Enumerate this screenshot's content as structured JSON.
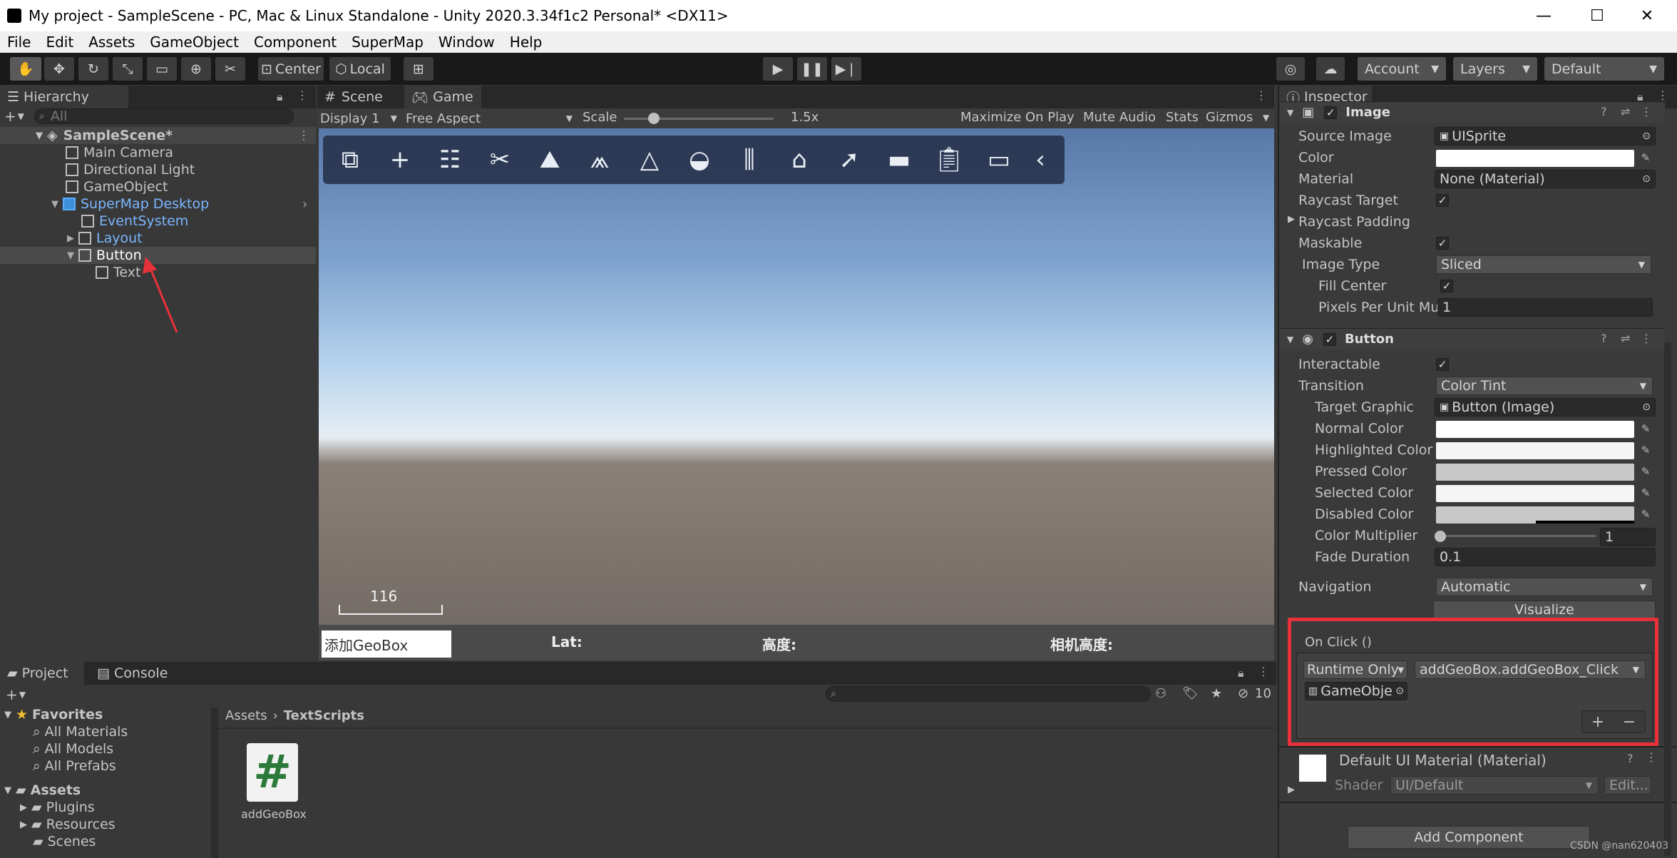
{
  "window": {
    "title": "My project - SampleScene - PC, Mac & Linux Standalone - Unity 2020.3.34f1c2 Personal* <DX11>"
  },
  "menu": [
    "File",
    "Edit",
    "Assets",
    "GameObject",
    "Component",
    "SuperMap",
    "Window",
    "Help"
  ],
  "toolbar": {
    "center": "Center",
    "local": "Local",
    "account": "Account",
    "layers": "Layers",
    "layout": "Default"
  },
  "hierarchy": {
    "tab": "Hierarchy",
    "search_placeholder": "All",
    "scene": "SampleScene*",
    "items": [
      {
        "label": "Main Camera"
      },
      {
        "label": "Directional Light"
      },
      {
        "label": "GameObject"
      },
      {
        "label": "SuperMap Desktop"
      },
      {
        "label": "EventSystem"
      },
      {
        "label": "Layout"
      },
      {
        "label": "Button"
      },
      {
        "label": "Text"
      }
    ]
  },
  "game": {
    "tabs": [
      "Scene",
      "Game"
    ],
    "display": "Display 1",
    "aspect": "Free Aspect",
    "scale_label": "Scale",
    "scale_value": "1.5x",
    "scale_fraction": 0.2,
    "maximize": "Maximize On Play",
    "mute": "Mute Audio",
    "stats": "Stats",
    "gizmos": "Gizmos",
    "scalebar_value": "116",
    "add_button": "添加GeoBox",
    "lat": "Lat:",
    "height": "高度:",
    "camera_height": "相机高度:"
  },
  "project": {
    "tabs": [
      "Project",
      "Console"
    ],
    "count": "10",
    "favorites": "Favorites",
    "favorite_items": [
      "All Materials",
      "All Models",
      "All Prefabs"
    ],
    "assets": "Assets",
    "asset_folders": [
      "Plugins",
      "Resources",
      "Scenes"
    ],
    "breadcrumb": [
      "Assets",
      "TextScripts"
    ],
    "file_name": "addGeoBox",
    "file_glyph": "#"
  },
  "inspector": {
    "tab": "Inspector",
    "image": {
      "title": "Image",
      "source_image_label": "Source Image",
      "source_image": "UISprite",
      "color_label": "Color",
      "material_label": "Material",
      "material": "None (Material)",
      "raycast_target": "Raycast Target",
      "raycast_padding": "Raycast Padding",
      "maskable": "Maskable",
      "image_type_label": "Image Type",
      "image_type": "Sliced",
      "fill_center": "Fill Center",
      "ppu_label": "Pixels Per Unit Mul",
      "ppu": "1"
    },
    "button": {
      "title": "Button",
      "interactable": "Interactable",
      "transition_label": "Transition",
      "transition": "Color Tint",
      "target_graphic_label": "Target Graphic",
      "target_graphic": "Button (Image)",
      "normal": "Normal Color",
      "highlighted": "Highlighted Color",
      "pressed": "Pressed Color",
      "selected": "Selected Color",
      "disabled": "Disabled Color",
      "multiplier_label": "Color Multiplier",
      "multiplier": "1",
      "fade_label": "Fade Duration",
      "fade": "0.1",
      "navigation_label": "Navigation",
      "navigation": "Automatic",
      "visualize": "Visualize"
    },
    "onclick": {
      "title": "On Click ()",
      "runtime": "Runtime Only",
      "function": "addGeoBox.addGeoBox_Click",
      "object": "GameObje",
      "plus": "+",
      "minus": "−"
    },
    "material": {
      "name": "Default UI Material (Material)",
      "shader_label": "Shader",
      "shader": "UI/Default",
      "edit": "Edit..."
    },
    "add_component": "Add Component"
  },
  "colors": {
    "normal": "#ffffff",
    "highlighted": "#f5f5f5",
    "pressed": "#c8c8c8",
    "selected": "#f5f5f5",
    "disabled": "#c8c8c8",
    "highlight_box": "#e8313a",
    "arrow": "#e8313a"
  },
  "watermark": "CSDN @nan620403"
}
